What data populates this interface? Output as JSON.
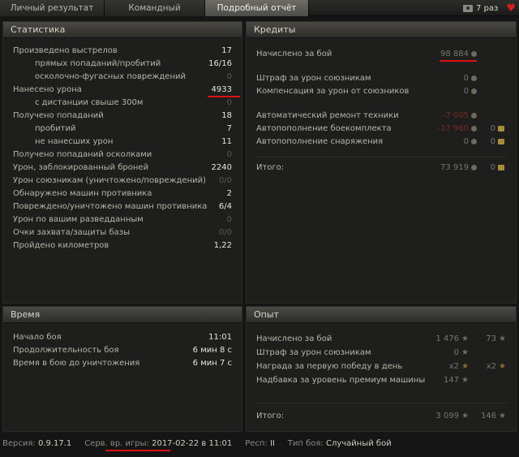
{
  "tabs": {
    "personal": "Личный результат",
    "team": "Командный результат",
    "detail": "Подробный отчёт",
    "times": "7 раз"
  },
  "stats": {
    "title": "Статистика",
    "rows": [
      {
        "label": "Произведено выстрелов",
        "value": "17"
      },
      {
        "label": "прямых попаданий/пробитий",
        "value": "16/16"
      },
      {
        "label": "осколочно-фугасных повреждений",
        "value": "0"
      },
      {
        "label": "Нанесено урона",
        "value": "4933"
      },
      {
        "label": "с дистанции свыше 300м",
        "value": "0"
      },
      {
        "label": "Получено попаданий",
        "value": "18"
      },
      {
        "label": "пробитий",
        "value": "7"
      },
      {
        "label": "не нанесших урон",
        "value": "11"
      },
      {
        "label": "Получено попаданий осколками",
        "value": "0"
      },
      {
        "label": "Урон, заблокированный броней",
        "value": "2240"
      },
      {
        "label": "Урон союзникам (уничтожено/повреждений)",
        "value": "0/0"
      },
      {
        "label": "Обнаружено машин противника",
        "value": "2"
      },
      {
        "label": "Повреждено/уничтожено машин противника",
        "value": "6/4"
      },
      {
        "label": "Урон по вашим разведданным",
        "value": "0"
      },
      {
        "label": "Очки захвата/защиты базы",
        "value": "0/0"
      },
      {
        "label": "Пройдено километров",
        "value": "1,22"
      }
    ]
  },
  "credits": {
    "title": "Кредиты",
    "earned_label": "Начислено за бой",
    "earned_value": "98 884",
    "fine_label": "Штраф за урон союзникам",
    "fine_value": "0",
    "comp_label": "Компенсация за урон от союзников",
    "comp_value": "0",
    "repair_label": "Автоматический ремонт техники",
    "repair_value": "-7 005",
    "ammo_label": "Автопополнение боекомплекта",
    "ammo_value": "-17 960",
    "ammo_gold": "0",
    "equip_label": "Автопополнение снаряжения",
    "equip_value": "0",
    "equip_gold": "0",
    "total_label": "Итого:",
    "total_value": "73 919",
    "total_gold": "0"
  },
  "time": {
    "title": "Время",
    "rows": [
      {
        "label": "Начало боя",
        "value": "11:01"
      },
      {
        "label": "Продолжительность боя",
        "value": "6 мин 8 с"
      },
      {
        "label": "Время в бою до уничтожения",
        "value": "6 мин 7 с"
      }
    ]
  },
  "xp": {
    "title": "Опыт",
    "earned_label": "Начислено за бой",
    "earned_value": "1 476",
    "earned_free": "73",
    "fine_label": "Штраф за урон союзникам",
    "fine_value": "0",
    "first_win_label": "Награда за первую победу в день",
    "first_win_value": "x2",
    "first_win_free": "x2",
    "premium_label": "Надбавка за уровень премиум машины",
    "premium_value": "147",
    "total_label": "Итого:",
    "total_value": "3 099",
    "total_free": "146"
  },
  "footer": {
    "version_label": "Версия:",
    "version_value": "0.9.17.1",
    "server_time_label": "Серв. вр. игры:",
    "server_time_value": "2017-02-22 в 11:01",
    "region_label": "Респ:",
    "region_value": "II",
    "battle_type_label": "Тип боя:",
    "battle_type_value": "Случайный бой"
  },
  "colors": {
    "annotation_underline": "#e01010",
    "active_tab": "#5d5c57",
    "background": "#151515"
  }
}
